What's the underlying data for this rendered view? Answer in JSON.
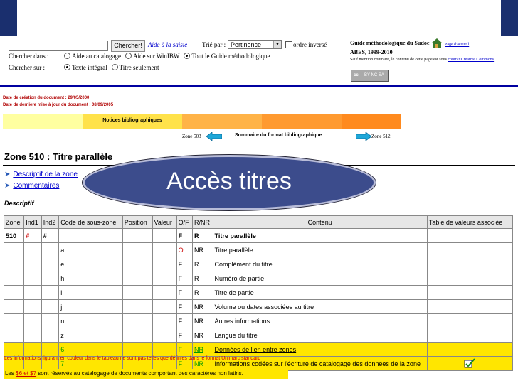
{
  "search": {
    "button": "Chercher!",
    "aide_link": "Aide à la saisie",
    "tri_label": "Trié par :",
    "tri_value": "Pertinence",
    "ordre_label": "ordre inversé",
    "chercher_dans_label": "Chercher dans :",
    "chercher_dans_options": [
      "Aide au catalogage",
      "Aide sur WinIBW",
      "Tout le Guide méthodologique"
    ],
    "chercher_sur_label": "Chercher sur :",
    "chercher_sur_options": [
      "Texte intégral",
      "Titre seulement"
    ]
  },
  "guide": {
    "title": "Guide méthodologique du Sudoc",
    "home": "Page d'accueil",
    "abes": "ABES, 1999-2010",
    "note": "Sauf mention contraire, le contenu de cette page est sous",
    "note_link": "contrat Creative Commons",
    "cc": "cc",
    "cc_terms": "BY NC SA"
  },
  "dates": {
    "creation": "Date de création du document : 29/05/2000",
    "update": "Date de dernière mise à jour du document : 08/09/2005"
  },
  "band": {
    "label": "Notices bibliographiques",
    "colors": [
      "#ffffa0",
      "#ffe24a",
      "#ffb347",
      "#ff9a30",
      "#ff8a1e"
    ]
  },
  "nav": {
    "prev": "Zone 503",
    "middle": "Sommaire du format bibliographique",
    "next": "Zone 512"
  },
  "zone_title": "Zone 510 : Titre parallèle",
  "links": [
    "Descriptif de la zone",
    "Commentaires"
  ],
  "descriptif": "Descriptif",
  "overlay": "Accès titres",
  "table": {
    "headers": [
      "Zone",
      "Ind1",
      "Ind2",
      "Code de sous-zone",
      "Position",
      "Valeur",
      "O/F",
      "R/NR",
      "Contenu",
      "Table de valeurs associée"
    ],
    "rows": [
      {
        "zone": "510",
        "ind1": "#",
        "ind2": "#",
        "code": "",
        "of": "F",
        "rnr": "R",
        "contenu": "Titre parallèle",
        "kind": "head"
      },
      {
        "code": "a",
        "of": "O",
        "rnr": "NR",
        "contenu": "Titre parallèle",
        "kind": "a"
      },
      {
        "code": "e",
        "of": "F",
        "rnr": "R",
        "contenu": "Complément du titre",
        "kind": "plain"
      },
      {
        "code": "h",
        "of": "F",
        "rnr": "R",
        "contenu": "Numéro de partie",
        "kind": "plain"
      },
      {
        "code": "i",
        "of": "F",
        "rnr": "R",
        "contenu": "Titre de partie",
        "kind": "plain"
      },
      {
        "code": "j",
        "of": "F",
        "rnr": "NR",
        "contenu": "Volume ou dates associées au titre",
        "kind": "plain"
      },
      {
        "code": "n",
        "of": "F",
        "rnr": "NR",
        "contenu": "Autres informations",
        "kind": "plain"
      },
      {
        "code": "z",
        "of": "F",
        "rnr": "NR",
        "contenu": "Langue du titre",
        "kind": "plain"
      },
      {
        "code": "6",
        "of": "F",
        "rnr": "NR",
        "contenu": "Données de lien entre zones",
        "kind": "yellow"
      },
      {
        "code": "7",
        "of": "F",
        "rnr": "NR",
        "contenu": "Informations codées sur l'écriture de catalogage des données de la zone",
        "kind": "yellow-icon"
      }
    ]
  },
  "footnote": "Les informations figurant en couleur dans le tableau ne sont pas telles que définies dans le format Unimarc standard",
  "note": {
    "prefix": "Les",
    "highlight": "$6 et $7",
    "suffix": "sont réservés au catalogage de documents comportant des caractères non latins."
  }
}
